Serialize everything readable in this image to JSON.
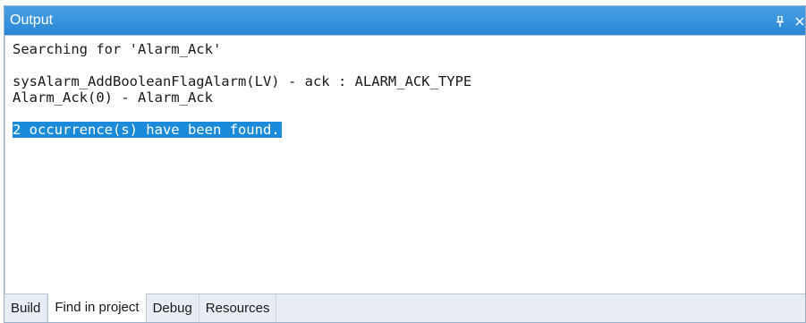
{
  "window": {
    "title": "Output",
    "pin_icon": "pin-icon",
    "close_icon": "close-icon"
  },
  "output": {
    "lines": [
      "Searching for 'Alarm_Ack'",
      "",
      "sysAlarm_AddBooleanFlagAlarm(LV) - ack : ALARM_ACK_TYPE",
      "Alarm_Ack(0) - Alarm_Ack",
      "",
      "2 occurrence(s) have been found."
    ]
  },
  "tabs": [
    {
      "label": "Build",
      "active": false
    },
    {
      "label": "Find in project",
      "active": true
    },
    {
      "label": "Debug",
      "active": false
    },
    {
      "label": "Resources",
      "active": false
    }
  ],
  "colors": {
    "titlebar": "#2a86d6",
    "selection": "#1b8ad8"
  }
}
